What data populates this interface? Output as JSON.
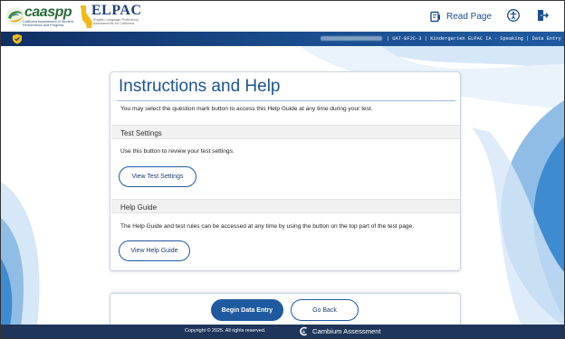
{
  "header": {
    "caaspp_logo_text": "caaspp",
    "caaspp_logo_sub": "California Assessment of Student Performance and Progress",
    "elpac_logo_text": "ELPAC",
    "elpac_logo_sub": "English Language Proficiency Assessments for California",
    "read_page_label": "Read Page"
  },
  "banner": {
    "session_info": "| UAT-BF2C-3 | Kindergarten ELPAC IA - Speaking | Data Entry"
  },
  "main": {
    "title": "Instructions and Help",
    "intro": "You may select the question mark button to access this Help Guide at any time during your test.",
    "sections": [
      {
        "heading": "Test Settings",
        "text": "Use this button to review your test settings.",
        "button_label": "View Test Settings"
      },
      {
        "heading": "Help Guide",
        "text": "The Help Guide and test rules can be accessed at any time by using the button on the top part of the test page.",
        "button_label": "View Help Guide"
      }
    ]
  },
  "actions": {
    "begin_label": "Begin Data Entry",
    "back_label": "Go Back"
  },
  "footer": {
    "copyright": "Copyright © 2025. All rights reserved.",
    "brand": "Cambium Assessment"
  },
  "colors": {
    "primary": "#1f5aa0",
    "title": "#1a5494",
    "banner": "#0f2f62",
    "footer": "#1f3559",
    "wave_light": "#d6e7f7",
    "wave_mid": "#8fbde6",
    "wave_dark": "#3f8bd0"
  },
  "icons": {
    "read_page": "speaker-page-icon",
    "accessibility": "accessibility-person-icon",
    "exit": "exit-door-icon",
    "security": "shield-check-icon",
    "brand": "cambium-logo-icon"
  }
}
